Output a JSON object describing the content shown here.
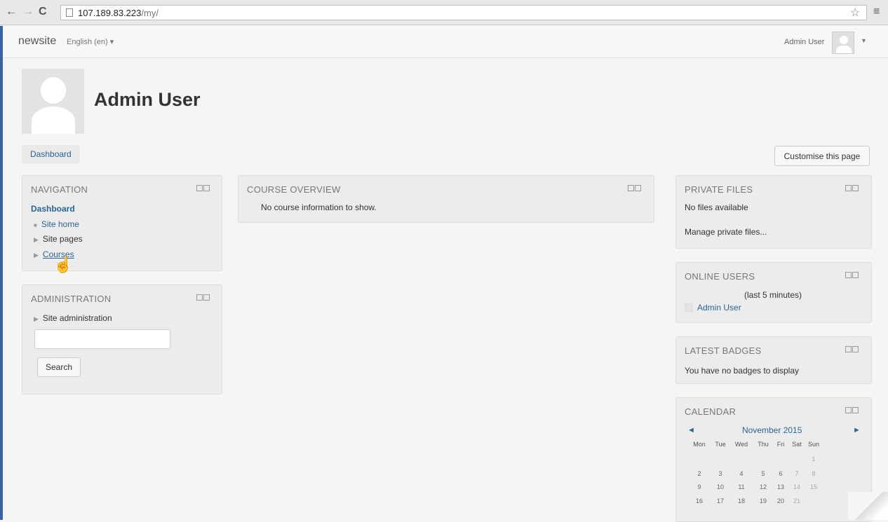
{
  "browser": {
    "url_host": "107.189.83.223",
    "url_path": "/my/"
  },
  "navbar": {
    "brand": "newsite",
    "language": "English (en) ▾",
    "user_name": "Admin User"
  },
  "header": {
    "title": "Admin User",
    "breadcrumb": "Dashboard",
    "customise_button": "Customise this page"
  },
  "navigation_block": {
    "title": "NAVIGATION",
    "dashboard": "Dashboard",
    "items": [
      {
        "label": "Site home"
      },
      {
        "label": "Site pages"
      },
      {
        "label": "Courses"
      }
    ]
  },
  "administration_block": {
    "title": "ADMINISTRATION",
    "site_admin": "Site administration",
    "search_button": "Search",
    "search_value": ""
  },
  "course_overview_block": {
    "title": "COURSE OVERVIEW",
    "message": "No course information to show."
  },
  "private_files_block": {
    "title": "PRIVATE FILES",
    "message": "No files available",
    "manage_link": "Manage private files..."
  },
  "online_users_block": {
    "title": "ONLINE USERS",
    "period": "(last 5 minutes)",
    "users": [
      "Admin User"
    ]
  },
  "latest_badges_block": {
    "title": "LATEST BADGES",
    "message": "You have no badges to display"
  },
  "calendar_block": {
    "title": "CALENDAR",
    "month": "November 2015",
    "prev": "◄",
    "next": "►",
    "day_headers": [
      "Mon",
      "Tue",
      "Wed",
      "Thu",
      "Fri",
      "Sat",
      "Sun"
    ],
    "weeks": [
      [
        "",
        "",
        "",
        "",
        "",
        "",
        "1"
      ],
      [
        "2",
        "3",
        "4",
        "5",
        "6",
        "7",
        "8"
      ],
      [
        "9",
        "10",
        "11",
        "12",
        "13",
        "14",
        "15"
      ],
      [
        "16",
        "17",
        "18",
        "19",
        "20",
        "21",
        ""
      ]
    ]
  },
  "colors": {
    "link": "#2a6496",
    "block_bg": "#ececec",
    "page_bg": "#f5f5f3",
    "frame_accent": "#3a63a0"
  }
}
